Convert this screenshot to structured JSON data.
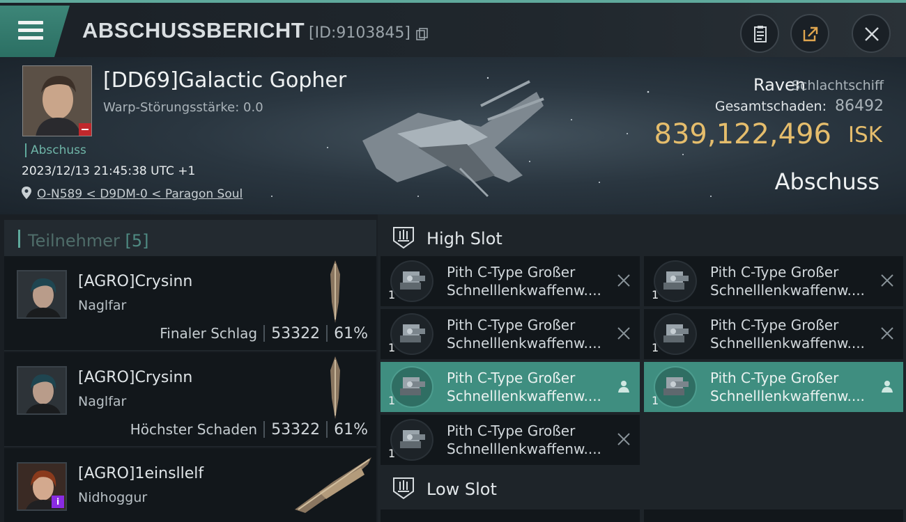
{
  "header": {
    "title": "ABSCHUSSBERICHT",
    "report_id": "[ID:9103845]"
  },
  "victim": {
    "name": "[DD69]Galactic Gopher",
    "warp_strength": "Warp-Störungsstärke: 0.0",
    "kill_tag": "Abschuss",
    "datetime": "2023/12/13 21:45:38 UTC +1",
    "location": "O-N589 < D9DM-0 < Paragon Soul",
    "ship_name": "Raven",
    "ship_class": "Schlachtschiff",
    "damage_label": "Gesamtschaden:",
    "damage_value": "86492",
    "isk_value": "839,122,496",
    "isk_unit": "ISK",
    "kill_type": "Abschuss"
  },
  "participants": {
    "title": "Teilnehmer",
    "count": "[5]",
    "rows": [
      {
        "name": "[AGRO]Crysinn",
        "ship": "Naglfar",
        "role": "Finaler Schlag",
        "damage": "53322",
        "percent": "61%"
      },
      {
        "name": "[AGRO]Crysinn",
        "ship": "Naglfar",
        "role": "Höchster Schaden",
        "damage": "53322",
        "percent": "61%"
      },
      {
        "name": "[AGRO]1einsllelf",
        "ship": "Nidhoggur"
      }
    ]
  },
  "slots": {
    "high_label": "High Slot",
    "low_label": "Low Slot",
    "modules": [
      {
        "line1": "Pith C-Type Großer",
        "line2": "Schnelllenkwaffenw....",
        "qty": "1",
        "status": "destroyed"
      },
      {
        "line1": "Pith C-Type Großer",
        "line2": "Schnelllenkwaffenw....",
        "qty": "1",
        "status": "destroyed"
      },
      {
        "line1": "Pith C-Type Großer",
        "line2": "Schnelllenkwaffenw....",
        "qty": "1",
        "status": "destroyed"
      },
      {
        "line1": "Pith C-Type Großer",
        "line2": "Schnelllenkwaffenw....",
        "qty": "1",
        "status": "destroyed"
      },
      {
        "line1": "Pith C-Type Großer",
        "line2": "Schnelllenkwaffenw....",
        "qty": "1",
        "status": "dropped"
      },
      {
        "line1": "Pith C-Type Großer",
        "line2": "Schnelllenkwaffenw....",
        "qty": "1",
        "status": "dropped"
      },
      {
        "line1": "Pith C-Type Großer",
        "line2": "Schnelllenkwaffenw....",
        "qty": "1",
        "status": "destroyed"
      }
    ]
  },
  "colors": {
    "accent": "#5fa99c",
    "isk": "#e5bd6c",
    "active_module": "#3f8e80"
  },
  "icons": [
    "menu-icon",
    "copy-icon",
    "clipboard-icon",
    "share-icon",
    "close-icon",
    "pin-icon",
    "high-slot-icon",
    "low-slot-icon",
    "destroyed-x-icon",
    "dropped-person-icon"
  ]
}
